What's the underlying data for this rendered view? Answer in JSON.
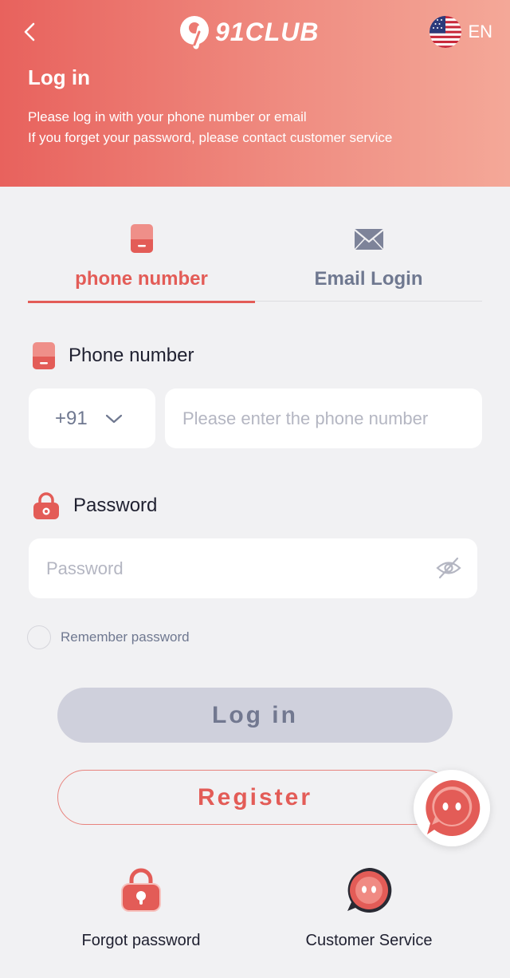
{
  "header": {
    "logo_text": "91CLUB",
    "language": "EN",
    "title": "Log in",
    "subtitle_line1": "Please log in with your phone number or email",
    "subtitle_line2": "If you forget your password, please contact customer service"
  },
  "tabs": [
    {
      "label": "phone number",
      "icon": "phone-icon",
      "active": true
    },
    {
      "label": "Email Login",
      "icon": "mail-icon",
      "active": false
    }
  ],
  "phone_field": {
    "label": "Phone number",
    "country_code": "+91",
    "placeholder": "Please enter the phone number",
    "value": ""
  },
  "password_field": {
    "label": "Password",
    "placeholder": "Password",
    "value": ""
  },
  "remember": {
    "label": "Remember password",
    "checked": false
  },
  "buttons": {
    "login": "Log in",
    "register": "Register"
  },
  "bottom": {
    "forgot": "Forgot password",
    "customer_service": "Customer Service"
  },
  "colors": {
    "accent": "#e35c57",
    "header_start": "#e8625d",
    "header_end": "#f4a898",
    "muted": "#6f7890",
    "disabled_button": "#cfd0dc"
  }
}
